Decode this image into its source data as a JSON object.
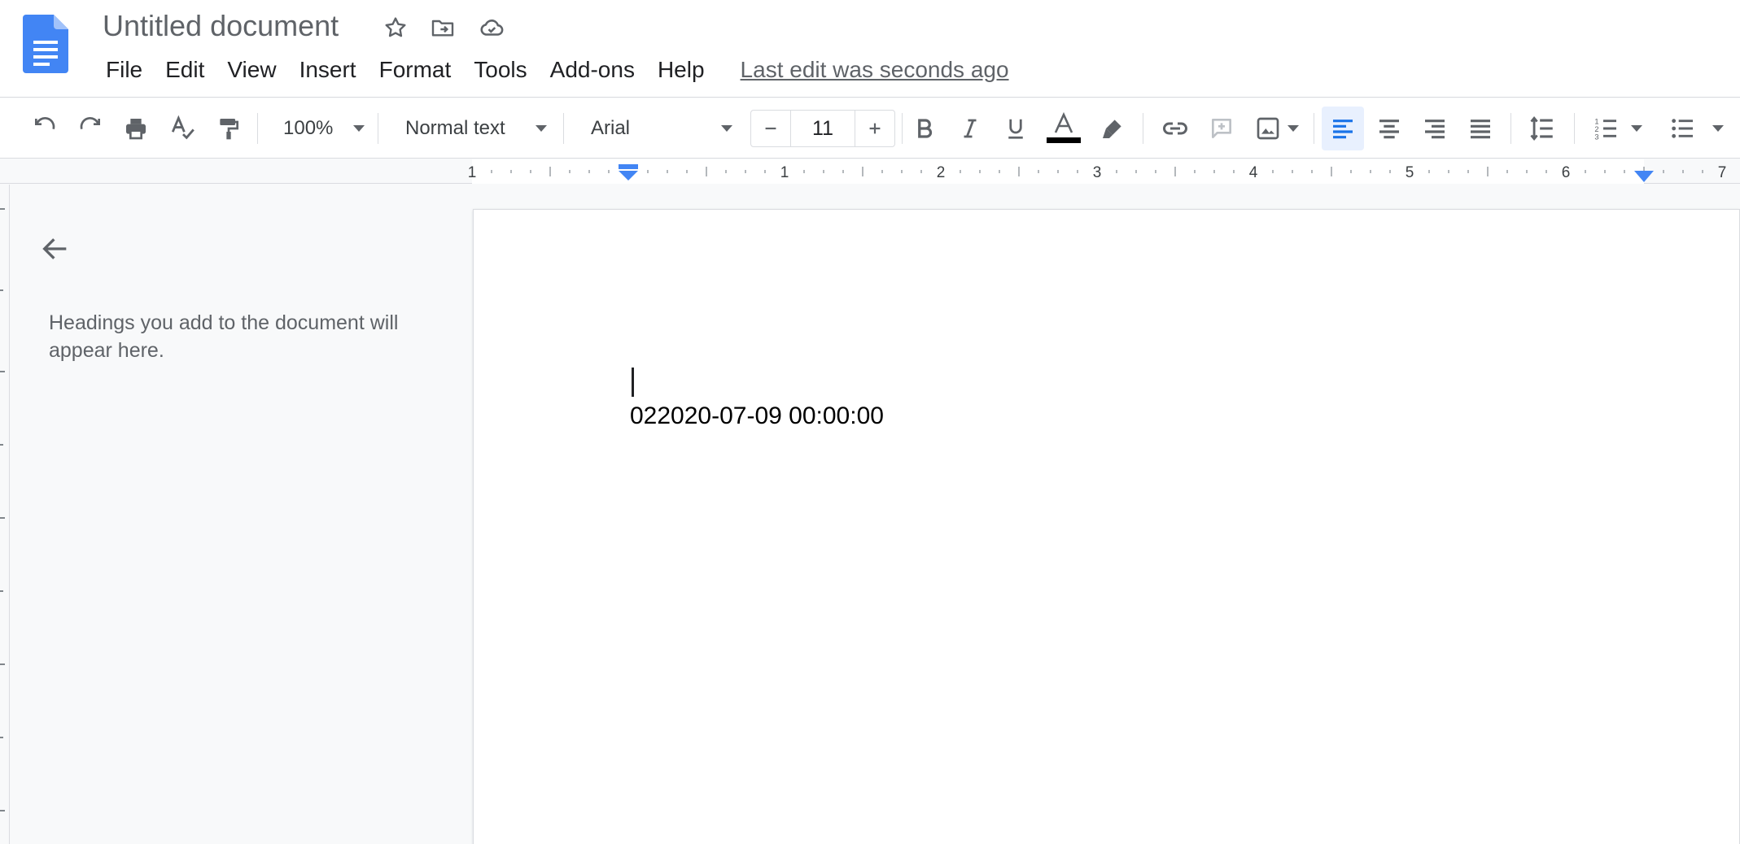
{
  "document": {
    "title": "Untitled document",
    "last_edit": "Last edit was seconds ago",
    "body_text": "022020-07-09 00:00:00"
  },
  "menu": {
    "items": [
      "File",
      "Edit",
      "View",
      "Insert",
      "Format",
      "Tools",
      "Add-ons",
      "Help"
    ]
  },
  "toolbar": {
    "zoom": "100%",
    "paragraph_style": "Normal text",
    "font": "Arial",
    "font_size": "11",
    "icons": [
      "undo-icon",
      "redo-icon",
      "print-icon",
      "spellcheck-icon",
      "paint-format-icon",
      "bold-icon",
      "italic-icon",
      "underline-icon",
      "text-color-icon",
      "highlight-icon",
      "link-icon",
      "add-comment-icon",
      "insert-image-icon",
      "align-left-icon",
      "align-center-icon",
      "align-right-icon",
      "justify-icon",
      "line-spacing-icon",
      "numbered-list-icon",
      "bulleted-list-icon"
    ]
  },
  "ruler": {
    "labels": [
      "1",
      "1",
      "2",
      "3",
      "4",
      "5",
      "6",
      "7"
    ]
  },
  "outline": {
    "hint": "Headings you add to the document will appear here."
  },
  "colors": {
    "brand_blue": "#4285f4",
    "active_blue": "#1a73e8",
    "icon_gray": "#5f6368",
    "text_color_bar": "#000000"
  }
}
